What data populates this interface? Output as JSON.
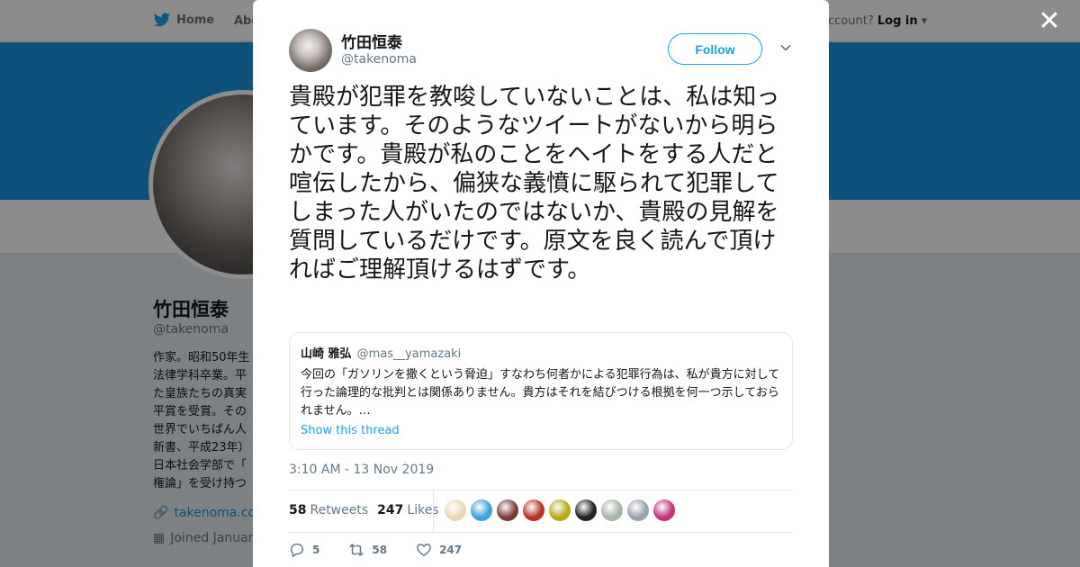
{
  "colors": {
    "accent": "#1da1f2",
    "banner": "#1b95e0"
  },
  "nav": {
    "home": "Home",
    "about": "Abo",
    "account_prompt": "ccount?",
    "login": "Log in"
  },
  "profile": {
    "name": "竹田恒泰",
    "handle": "@takenoma",
    "bio_lines": [
      "作家。昭和50年生",
      "法律学科卒業。平",
      "た皇族たちの真実",
      "平賞を受賞。その",
      "世界でいちばん人",
      "新書、平成23年）",
      "日本社会学部で「",
      "権論」を受け持つ"
    ],
    "link": "takenoma.com",
    "joined": "Joined Januar"
  },
  "tweet": {
    "author_name": "竹田恒泰",
    "author_handle": "@takenoma",
    "follow_label": "Follow",
    "text": "貴殿が犯罪を教唆していないことは、私は知っています。そのようなツイートがないから明らかです。貴殿が私のことをヘイトをする人だと喧伝したから、偏狭な義憤に駆られて犯罪してしまった人がいたのではないか、貴殿の見解を質問しているだけです。原文を良く読んで頂ければご理解頂けるはずです。",
    "timestamp": "3:10 AM - 13 Nov 2019",
    "retweets_count": "58",
    "retweets_label": "Retweets",
    "likes_count": "247",
    "likes_label": "Likes",
    "reply_count": "5",
    "retweet_action_count": "58",
    "like_action_count": "247"
  },
  "quoted": {
    "name": "山崎 雅弘",
    "handle": "@mas__yamazaki",
    "text": "今回の「ガソリンを撒くという脅迫」すなわち何者かによる犯罪行為は、私が貴方に対して行った論理的な批判とは関係ありません。貴方はそれを結びつける根拠を何一つ示しておられません。…",
    "thread_link": "Show this thread"
  },
  "likers": [
    {
      "color": "#e8d9b5"
    },
    {
      "color": "#3aa3d8"
    },
    {
      "color": "#7a3b3b"
    },
    {
      "color": "#b83226"
    },
    {
      "color": "#b8a81a"
    },
    {
      "color": "#222222"
    },
    {
      "color": "#a7b4a8"
    },
    {
      "color": "#9aa3ab"
    },
    {
      "color": "#c4317a"
    }
  ]
}
